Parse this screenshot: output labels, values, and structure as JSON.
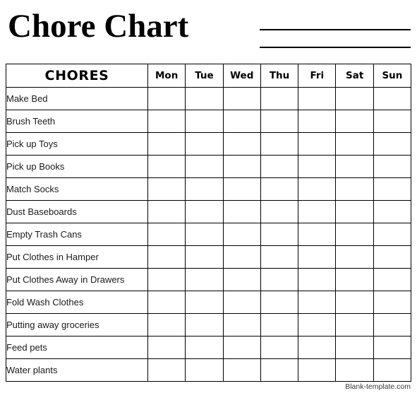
{
  "page": {
    "title": "Chore Chart",
    "background_color": "#ffffff",
    "text_color": "#000000"
  },
  "header": {
    "title": "Chore Chart",
    "write_in_lines": [
      "",
      ""
    ]
  },
  "table": {
    "chores_header": "CHORES",
    "day_headers": [
      "Mon",
      "Tue",
      "Wed",
      "Thu",
      "Fri",
      "Sat",
      "Sun"
    ],
    "rows": [
      {
        "chore": "Make Bed",
        "checks": [
          "",
          "",
          "",
          "",
          "",
          "",
          ""
        ]
      },
      {
        "chore": "Brush Teeth",
        "checks": [
          "",
          "",
          "",
          "",
          "",
          "",
          ""
        ]
      },
      {
        "chore": "Pick up Toys",
        "checks": [
          "",
          "",
          "",
          "",
          "",
          "",
          ""
        ]
      },
      {
        "chore": "Pick up Books",
        "checks": [
          "",
          "",
          "",
          "",
          "",
          "",
          ""
        ]
      },
      {
        "chore": "Match Socks",
        "checks": [
          "",
          "",
          "",
          "",
          "",
          "",
          ""
        ]
      },
      {
        "chore": "Dust Baseboards",
        "checks": [
          "",
          "",
          "",
          "",
          "",
          "",
          ""
        ]
      },
      {
        "chore": "Empty Trash Cans",
        "checks": [
          "",
          "",
          "",
          "",
          "",
          "",
          ""
        ]
      },
      {
        "chore": "Put Clothes in Hamper",
        "checks": [
          "",
          "",
          "",
          "",
          "",
          "",
          ""
        ]
      },
      {
        "chore": "Put Clothes Away in Drawers",
        "checks": [
          "",
          "",
          "",
          "",
          "",
          "",
          ""
        ]
      },
      {
        "chore": "Fold Wash Clothes",
        "checks": [
          "",
          "",
          "",
          "",
          "",
          "",
          ""
        ]
      },
      {
        "chore": "Putting away groceries",
        "checks": [
          "",
          "",
          "",
          "",
          "",
          "",
          ""
        ]
      },
      {
        "chore": "Feed pets",
        "checks": [
          "",
          "",
          "",
          "",
          "",
          "",
          ""
        ]
      },
      {
        "chore": "Water plants",
        "checks": [
          "",
          "",
          "",
          "",
          "",
          "",
          ""
        ]
      }
    ]
  },
  "footer": {
    "credit": "Blank-template.com"
  }
}
